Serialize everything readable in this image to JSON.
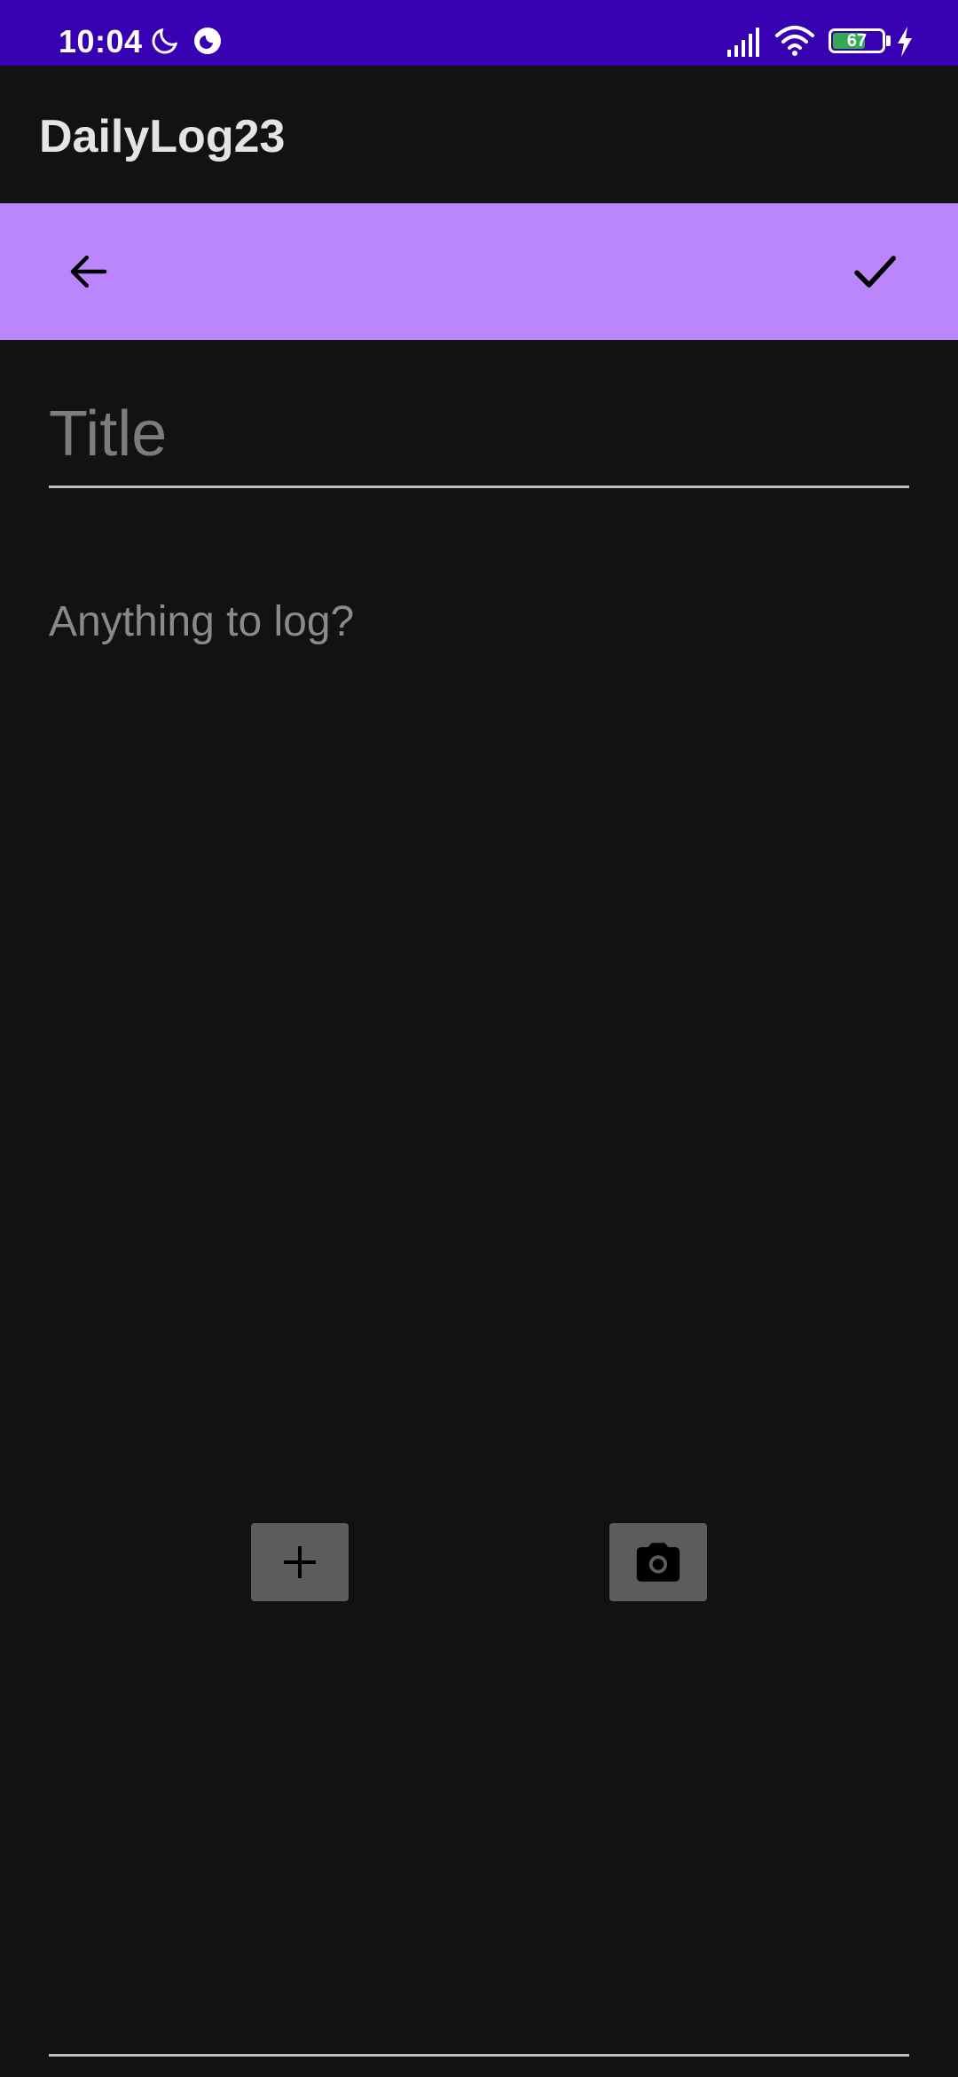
{
  "status_bar": {
    "time": "10:04",
    "battery_level": "67",
    "battery_fraction": 0.67,
    "icons": [
      "moon-icon",
      "night-mode-icon",
      "signal-icon",
      "wifi-icon",
      "battery-icon",
      "charging-icon"
    ],
    "background_color": "#3700b3"
  },
  "app_bar": {
    "title": "DailyLog23"
  },
  "toolbar": {
    "background_color": "#bb86fc",
    "back_icon": "arrow-back-icon",
    "save_icon": "check-icon"
  },
  "editor": {
    "title_placeholder": "Title",
    "title_value": "",
    "body_placeholder": "Anything to log?",
    "body_value": ""
  },
  "actions": {
    "add_icon": "plus-icon",
    "camera_icon": "camera-icon"
  }
}
